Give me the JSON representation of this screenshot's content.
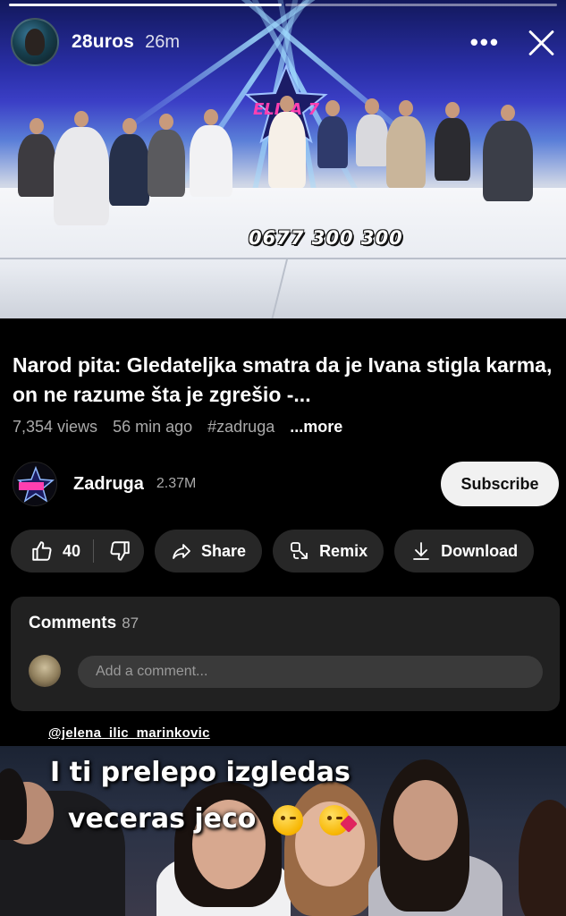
{
  "story": {
    "username": "28uros",
    "time": "26m",
    "more_icon": "ellipsis-icon",
    "close_icon": "close-icon",
    "progress_segments": 2,
    "progress_done": 1
  },
  "video": {
    "overlay_phone": "0677 300 300",
    "logo_text": "ELITA 7"
  },
  "youtube": {
    "title": "Narod pita: Gledateljka smatra da je Ivana stigla karma, on ne razume šta je zgrešio -...",
    "views": "7,354 views",
    "age": "56 min ago",
    "hashtag": "#zadruga",
    "more": "...more",
    "channel": {
      "name": "Zadruga",
      "subscribers": "2.37M",
      "subscribe_label": "Subscribe"
    },
    "actions": {
      "like_count": "40",
      "share_label": "Share",
      "remix_label": "Remix",
      "download_label": "Download"
    },
    "comments": {
      "title": "Comments",
      "count": "87",
      "placeholder": "Add a comment..."
    }
  },
  "overlay": {
    "mention": "@jelena_ilic_marinkovic",
    "caption_line1": "I ti prelepo izgledas",
    "caption_line2": "veceras jeco"
  },
  "colors": {
    "background": "#000000",
    "pill": "#272727",
    "card": "#212121",
    "subscribe_bg": "#f1f1f1",
    "muted_text": "#aaaaaa"
  }
}
